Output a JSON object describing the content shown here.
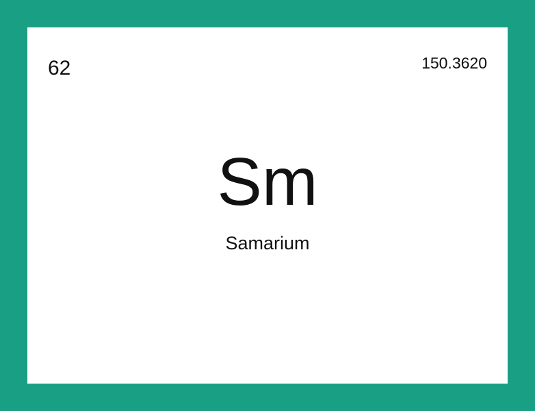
{
  "element": {
    "atomic_number": "62",
    "atomic_mass": "150.3620",
    "symbol": "Sm",
    "name": "Samarium"
  },
  "colors": {
    "background": "#189f84",
    "card": "#ffffff",
    "text": "#111111"
  }
}
